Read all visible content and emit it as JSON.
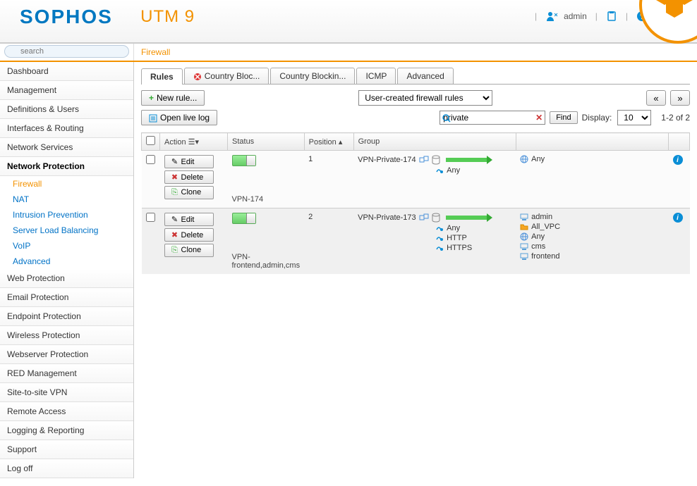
{
  "brand": {
    "logo1": "SOPHOS",
    "logo2": "UTM 9"
  },
  "header": {
    "user": "admin"
  },
  "search": {
    "placeholder": "search"
  },
  "breadcrumb": "Firewall",
  "sidebar": {
    "items": [
      {
        "label": "Dashboard"
      },
      {
        "label": "Management"
      },
      {
        "label": "Definitions & Users"
      },
      {
        "label": "Interfaces & Routing"
      },
      {
        "label": "Network Services"
      },
      {
        "label": "Network Protection",
        "active": true,
        "subs": [
          {
            "label": "Firewall",
            "active": true
          },
          {
            "label": "NAT"
          },
          {
            "label": "Intrusion Prevention"
          },
          {
            "label": "Server Load Balancing"
          },
          {
            "label": "VoIP"
          },
          {
            "label": "Advanced"
          }
        ]
      },
      {
        "label": "Web Protection"
      },
      {
        "label": "Email Protection"
      },
      {
        "label": "Endpoint Protection"
      },
      {
        "label": "Wireless Protection"
      },
      {
        "label": "Webserver Protection"
      },
      {
        "label": "RED Management"
      },
      {
        "label": "Site-to-site VPN"
      },
      {
        "label": "Remote Access"
      },
      {
        "label": "Logging & Reporting"
      },
      {
        "label": "Support"
      },
      {
        "label": "Log off"
      }
    ]
  },
  "tabs": [
    {
      "label": "Rules",
      "active": true
    },
    {
      "label": "Country Bloc...",
      "blocked": true
    },
    {
      "label": "Country Blockin..."
    },
    {
      "label": "ICMP"
    },
    {
      "label": "Advanced"
    }
  ],
  "toolbar": {
    "new_rule": "New rule...",
    "open_log": "Open live log",
    "filter_select": "User-created firewall rules",
    "search_value": "private",
    "find": "Find",
    "display_label": "Display:",
    "display_value": "10",
    "pager": "1-2 of 2",
    "prev": "«",
    "next": "»"
  },
  "columns": {
    "action": "Action",
    "status": "Status",
    "position": "Position",
    "group": "Group"
  },
  "row_actions": {
    "edit": "Edit",
    "delete": "Delete",
    "clone": "Clone"
  },
  "rules": [
    {
      "position": "1",
      "source": "VPN-Private-174",
      "services": [
        "Any"
      ],
      "dests": [
        {
          "label": "Any",
          "icon": "globe"
        }
      ],
      "name": "VPN-174"
    },
    {
      "position": "2",
      "source": "VPN-Private-173",
      "services": [
        "Any",
        "HTTP",
        "HTTPS"
      ],
      "dests": [
        {
          "label": "admin",
          "icon": "host"
        },
        {
          "label": "All_VPC",
          "icon": "folder"
        },
        {
          "label": "Any",
          "icon": "globe"
        },
        {
          "label": "cms",
          "icon": "host"
        },
        {
          "label": "frontend",
          "icon": "host"
        }
      ],
      "name": "VPN-frontend,admin,cms"
    }
  ]
}
